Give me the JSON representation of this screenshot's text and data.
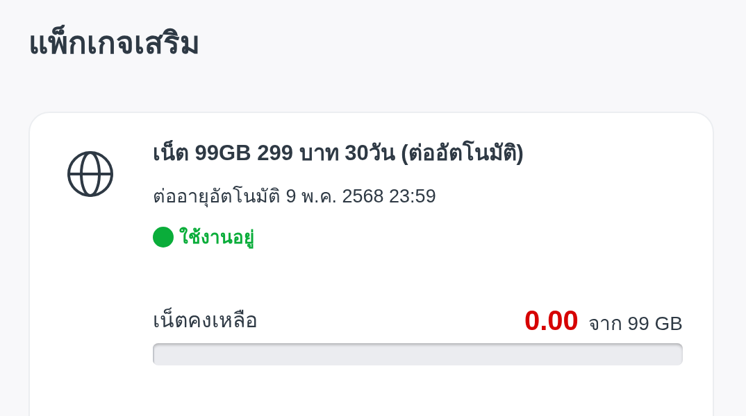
{
  "page_title": "แพ็กเกจเสริม",
  "package": {
    "title": "เน็ต 99GB 299 บาท 30วัน (ต่ออัตโนมัติ)",
    "renewal": "ต่ออายุอัตโนมัติ 9 พ.ค. 2568 23:59",
    "status": {
      "label": "ใช้งานอยู่",
      "active": true
    },
    "remaining": {
      "label": "เน็ตคงเหลือ",
      "amount": "0.00",
      "total": "จาก 99 GB",
      "level": 0
    }
  }
}
